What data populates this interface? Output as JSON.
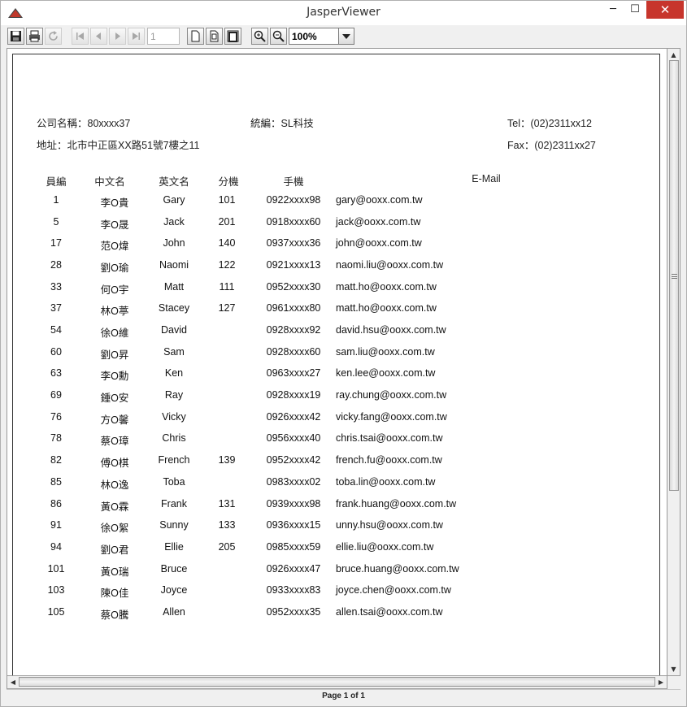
{
  "window": {
    "title": "JasperViewer",
    "minimize_glyph": "─",
    "maximize_glyph": "☐",
    "close_glyph": "✕"
  },
  "toolbar": {
    "icons": [
      "save-icon",
      "print-icon",
      "reload-icon",
      "first-page-icon",
      "previous-page-icon",
      "next-page-icon",
      "last-page-icon",
      "actual-size-icon",
      "fit-page-icon",
      "fit-width-icon",
      "zoom-in-icon",
      "zoom-out-icon"
    ],
    "page_number": "1",
    "zoom": "100%"
  },
  "report": {
    "company_label": "公司名稱：80xxxx37",
    "tax_label": "統編：SL科技",
    "tel_label": "Tel：(02)2311xx12",
    "address_label": "地址：北市中正區XX路51號7樓之11",
    "fax_label": "Fax：(02)2311xx27",
    "columns": [
      "員編",
      "中文名",
      "英文名",
      "分機",
      "手機",
      "E-Mail"
    ],
    "rows": [
      {
        "id": "1",
        "cn": "李O貴",
        "en": "Gary",
        "ext": "101",
        "mobile": "0922xxxx98",
        "email": "gary@ooxx.com.tw"
      },
      {
        "id": "5",
        "cn": "李O晟",
        "en": "Jack",
        "ext": "201",
        "mobile": "0918xxxx60",
        "email": "jack@ooxx.com.tw"
      },
      {
        "id": "17",
        "cn": "范O煒",
        "en": "John",
        "ext": "140",
        "mobile": "0937xxxx36",
        "email": "john@ooxx.com.tw"
      },
      {
        "id": "28",
        "cn": "劉O瑜",
        "en": "Naomi",
        "ext": "122",
        "mobile": "0921xxxx13",
        "email": "naomi.liu@ooxx.com.tw"
      },
      {
        "id": "33",
        "cn": "何O宇",
        "en": "Matt",
        "ext": "111",
        "mobile": "0952xxxx30",
        "email": "matt.ho@ooxx.com.tw"
      },
      {
        "id": "37",
        "cn": "林O葶",
        "en": "Stacey",
        "ext": "127",
        "mobile": "0961xxxx80",
        "email": "matt.ho@ooxx.com.tw"
      },
      {
        "id": "54",
        "cn": "徐O維",
        "en": "David",
        "ext": "",
        "mobile": "0928xxxx92",
        "email": "david.hsu@ooxx.com.tw"
      },
      {
        "id": "60",
        "cn": "劉O昇",
        "en": "Sam",
        "ext": "",
        "mobile": "0928xxxx60",
        "email": "sam.liu@ooxx.com.tw"
      },
      {
        "id": "63",
        "cn": "李O勳",
        "en": "Ken",
        "ext": "",
        "mobile": "0963xxxx27",
        "email": "ken.lee@ooxx.com.tw"
      },
      {
        "id": "69",
        "cn": "鍾O安",
        "en": "Ray",
        "ext": "",
        "mobile": "0928xxxx19",
        "email": "ray.chung@ooxx.com.tw"
      },
      {
        "id": "76",
        "cn": "方O馨",
        "en": "Vicky",
        "ext": "",
        "mobile": "0926xxxx42",
        "email": "vicky.fang@ooxx.com.tw"
      },
      {
        "id": "78",
        "cn": "蔡O璋",
        "en": "Chris",
        "ext": "",
        "mobile": "0956xxxx40",
        "email": "chris.tsai@ooxx.com.tw"
      },
      {
        "id": "82",
        "cn": "傅O棋",
        "en": "French",
        "ext": "139",
        "mobile": "0952xxxx42",
        "email": "french.fu@ooxx.com.tw"
      },
      {
        "id": "85",
        "cn": "林O逸",
        "en": "Toba",
        "ext": "",
        "mobile": "0983xxxx02",
        "email": "toba.lin@ooxx.com.tw"
      },
      {
        "id": "86",
        "cn": "黃O霖",
        "en": "Frank",
        "ext": "131",
        "mobile": "0939xxxx98",
        "email": "frank.huang@ooxx.com.tw"
      },
      {
        "id": "91",
        "cn": "徐O絮",
        "en": "Sunny",
        "ext": "133",
        "mobile": "0936xxxx15",
        "email": "unny.hsu@ooxx.com.tw"
      },
      {
        "id": "94",
        "cn": "劉O君",
        "en": "Ellie",
        "ext": "205",
        "mobile": "0985xxxx59",
        "email": "ellie.liu@ooxx.com.tw"
      },
      {
        "id": "101",
        "cn": "黃O瑞",
        "en": "Bruce",
        "ext": "",
        "mobile": "0926xxxx47",
        "email": "bruce.huang@ooxx.com.tw"
      },
      {
        "id": "103",
        "cn": "陳O佳",
        "en": "Joyce",
        "ext": "",
        "mobile": "0933xxxx83",
        "email": "joyce.chen@ooxx.com.tw"
      },
      {
        "id": "105",
        "cn": "蔡O騰",
        "en": "Allen",
        "ext": "",
        "mobile": "0952xxxx35",
        "email": "allen.tsai@ooxx.com.tw"
      }
    ]
  },
  "status": {
    "page_text": "Page 1 of 1"
  },
  "colors": {
    "close_button": "#c7352c",
    "window_bg": "#f0f0f0"
  }
}
